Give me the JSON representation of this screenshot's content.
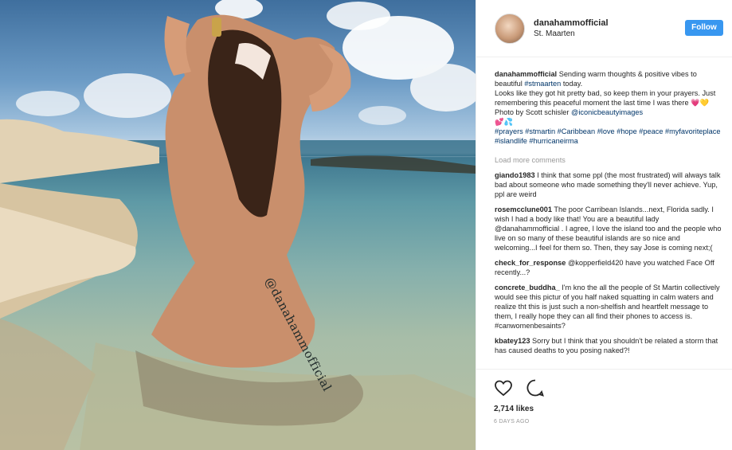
{
  "post": {
    "username": "danahammofficial",
    "location": "St. Maarten",
    "follow_label": "Follow",
    "watermark": "@danahammofficial"
  },
  "caption": {
    "username": "danahammofficial",
    "line1": "Sending warm thoughts & positive vibes to beautiful",
    "hashtag1": "#stmaarten",
    "line1_end": "today.",
    "line2": "Looks like they got hit pretty bad, so keep them in your prayers. Just remembering this peaceful moment the last time I was there 💗💛",
    "line3_pre": "Photo by Scott schisler",
    "mention": "@iconicbeautyimages",
    "emoji": "💕💦",
    "hashtags": "#prayers #stmartin #Caribbean #love #hope #peace #myfavoriteplace #islandlife #hurricaneirma"
  },
  "load_more": "Load more comments",
  "comments": [
    {
      "user": "giando1983",
      "text": "I think that some ppl (the most frustrated) will always talk bad about someone who made something they'll never achieve. Yup, ppl are weird"
    },
    {
      "user": "rosemcclune001",
      "text": "The poor Carribean Islands...next, Florida sadly. I wish I had a body like that! You are a beautiful lady @danahammofficial . I agree, I love the island too and the people who live on so many of these beautiful islands are so nice and welcoming...I feel for them so. Then, they say Jose is coming next;("
    },
    {
      "user": "check_for_response",
      "text": "@kopperfield420 have you watched Face Off recently...?"
    },
    {
      "user": "concrete_buddha_",
      "text": "I'm kno the all the people of St Martin collectively would see this pictur of you half naked squatting in calm waters and realize tht this is just such a non-shelfish and heartfelt message to them, I really hope they can all find their phones to access is. #canwomenbesaints?"
    },
    {
      "user": "kbatey123",
      "text": "Sorry but I think that you shouldn't be related a storm that has caused deaths to you posing naked?!"
    }
  ],
  "likes": "2,714 likes",
  "timestamp": "6 DAYS AGO",
  "icons": {
    "like": "heart-icon",
    "comment": "comment-bubble-icon"
  },
  "colors": {
    "follow_button": "#3897f0",
    "link": "#003569",
    "muted": "#999999"
  }
}
